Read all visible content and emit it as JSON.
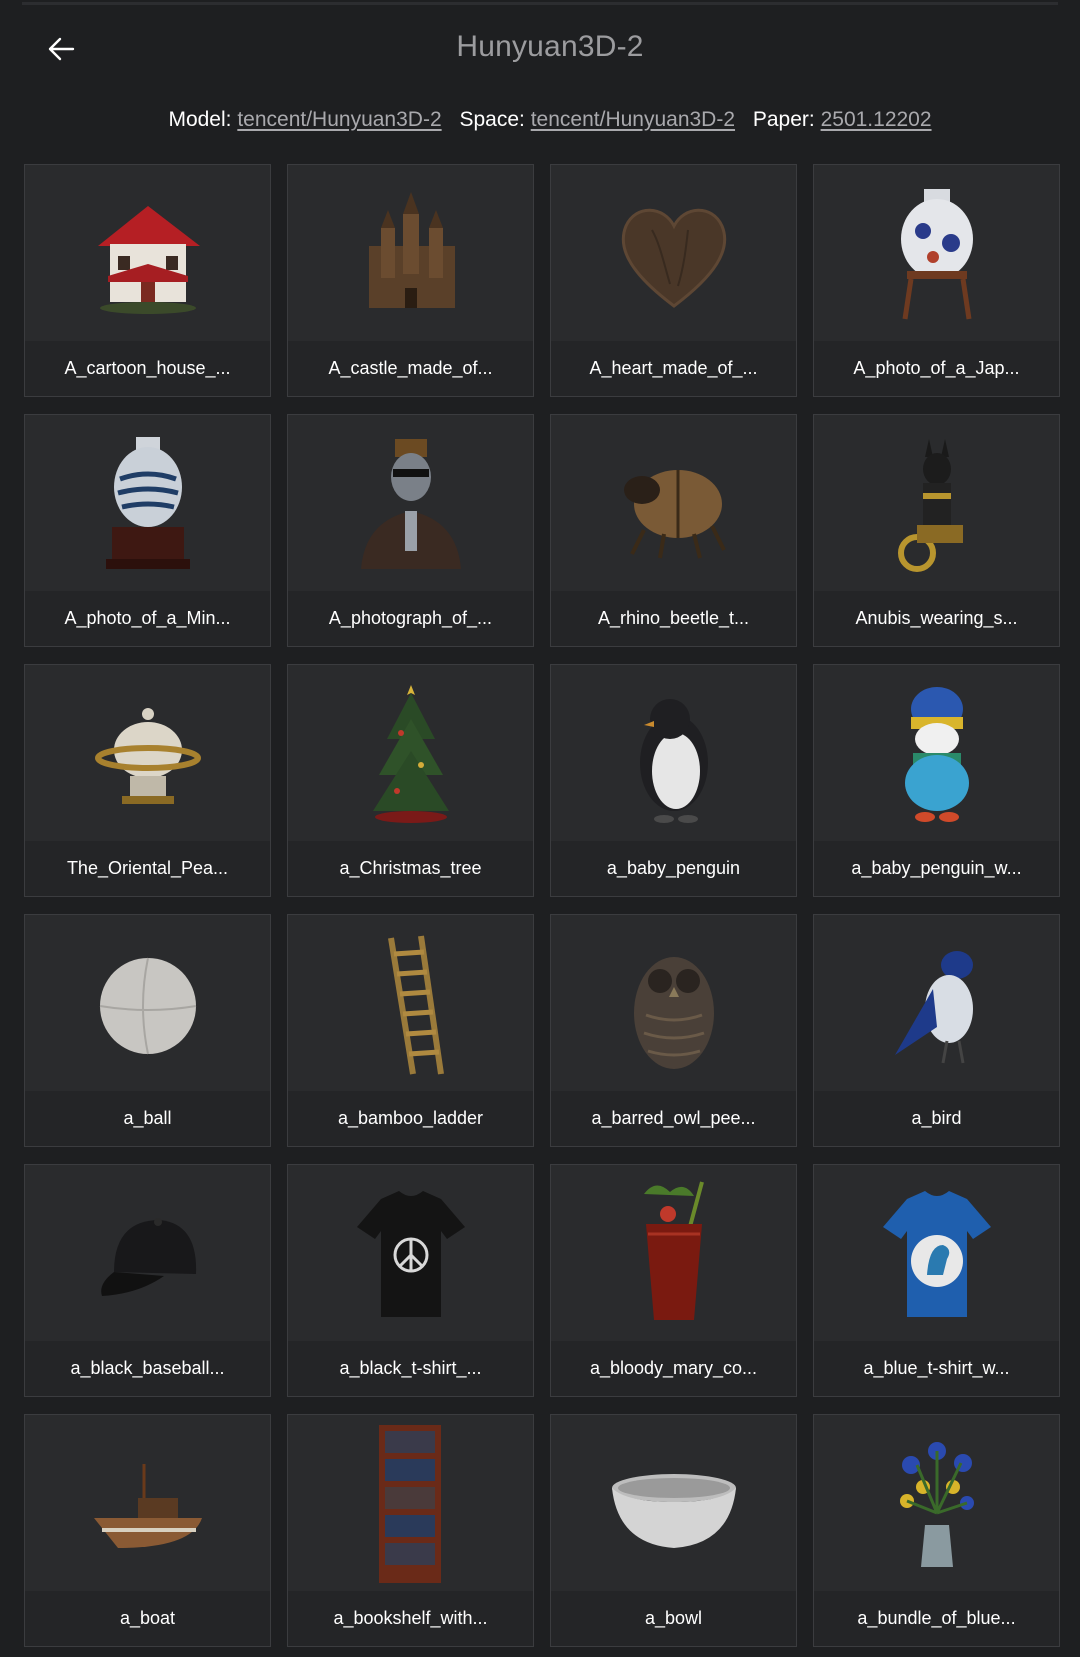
{
  "header": {
    "title": "Hunyuan3D-2",
    "back_icon": "arrow-left-icon"
  },
  "links": {
    "model_label": "Model:",
    "model_value": "tencent/Hunyuan3D-2",
    "space_label": "Space:",
    "space_value": "tencent/Hunyuan3D-2",
    "paper_label": "Paper:",
    "paper_value": "2501.12202"
  },
  "gallery": {
    "items": [
      {
        "label": "A_cartoon_house_...",
        "icon": "house-model"
      },
      {
        "label": "A_castle_made_of...",
        "icon": "castle-model"
      },
      {
        "label": "A_heart_made_of_...",
        "icon": "wooden-heart-model"
      },
      {
        "label": "A_photo_of_a_Jap...",
        "icon": "japanese-vase-model"
      },
      {
        "label": "A_photo_of_a_Min...",
        "icon": "ming-vase-model"
      },
      {
        "label": "A_photograph_of_...",
        "icon": "bust-model"
      },
      {
        "label": "A_rhino_beetle_t...",
        "icon": "beetle-model"
      },
      {
        "label": "Anubis_wearing_s...",
        "icon": "anubis-motorcycle-model"
      },
      {
        "label": "The_Oriental_Pea...",
        "icon": "oriental-pearl-model"
      },
      {
        "label": "a_Christmas_tree",
        "icon": "christmas-tree-model"
      },
      {
        "label": "a_baby_penguin",
        "icon": "penguin-model"
      },
      {
        "label": "a_baby_penguin_w...",
        "icon": "penguin-hat-model"
      },
      {
        "label": "a_ball",
        "icon": "ball-model"
      },
      {
        "label": "a_bamboo_ladder",
        "icon": "ladder-model"
      },
      {
        "label": "a_barred_owl_pee...",
        "icon": "owl-model"
      },
      {
        "label": "a_bird",
        "icon": "bird-model"
      },
      {
        "label": "a_black_baseball...",
        "icon": "baseball-cap-model"
      },
      {
        "label": "a_black_t-shirt_...",
        "icon": "black-tshirt-model"
      },
      {
        "label": "a_bloody_mary_co...",
        "icon": "cocktail-model"
      },
      {
        "label": "a_blue_t-shirt_w...",
        "icon": "blue-tshirt-model"
      },
      {
        "label": "a_boat",
        "icon": "boat-model"
      },
      {
        "label": "a_bookshelf_with...",
        "icon": "bookshelf-model"
      },
      {
        "label": "a_bowl",
        "icon": "bowl-model"
      },
      {
        "label": "a_bundle_of_blue...",
        "icon": "flowers-model"
      }
    ]
  },
  "colors": {
    "background": "#1e1f21",
    "card": "#2a2b2d",
    "caption_bg": "#242527",
    "title": "#9c9c9f",
    "link": "#a9a9ad"
  }
}
